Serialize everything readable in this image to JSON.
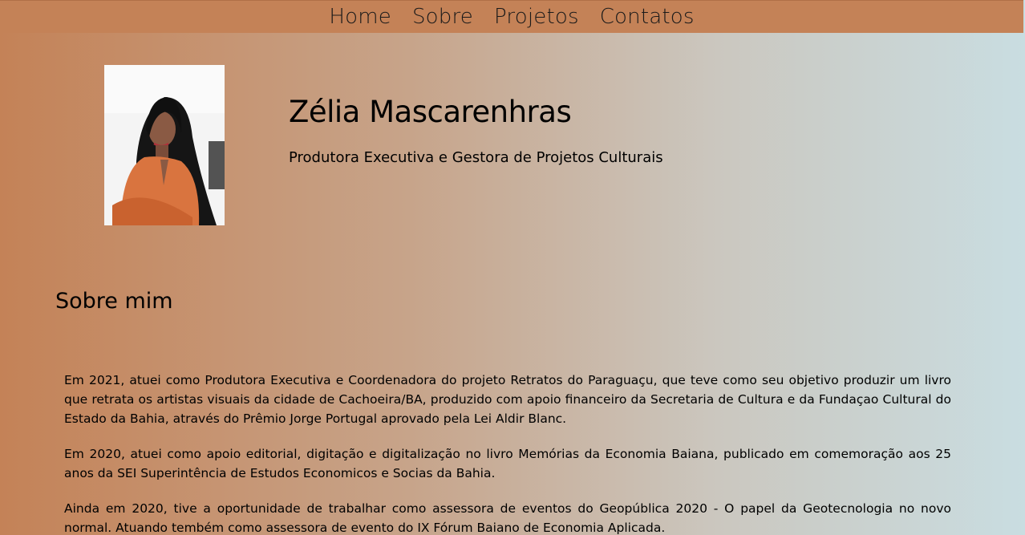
{
  "nav": {
    "items": [
      {
        "label": "Home"
      },
      {
        "label": "Sobre"
      },
      {
        "label": "Projetos"
      },
      {
        "label": "Contatos"
      }
    ]
  },
  "profile": {
    "name": "Zélia Mascarenhras",
    "role": "Produtora Executiva e Gestora de Projetos Culturais"
  },
  "about": {
    "title": "Sobre mim",
    "paragraphs": [
      "Em 2021, atuei como Produtora Executiva e Coordenadora do projeto Retratos do Paraguaçu, que teve como seu objetivo produzir um livro que retrata os artistas visuais da cidade de Cachoeira/BA, produzido com apoio financeiro da Secretaria de Cultura e da Fundaçao Cultural do Estado da Bahia, através do Prêmio Jorge Portugal aprovado pela Lei Aldir Blanc.",
      "Em 2020, atuei como apoio editorial, digitação e digitalização no livro Memórias da Economia Baiana, publicado em comemoração aos 25 anos da SEI Superintência de Estudos Economicos e Socias da Bahia.",
      "Ainda em 2020, tive a oportunidade de trabalhar como assessora de eventos do Geopública 2020 - O papel da Geotecnologia no novo normal. Atuando tembém como assessora de evento do IX Fórum Baiano de Economia Aplicada."
    ]
  },
  "colors": {
    "nav_bg": "#c48257",
    "gradient_start": "#c48257",
    "gradient_end": "#c9dde1",
    "blouse": "#d9743f"
  }
}
